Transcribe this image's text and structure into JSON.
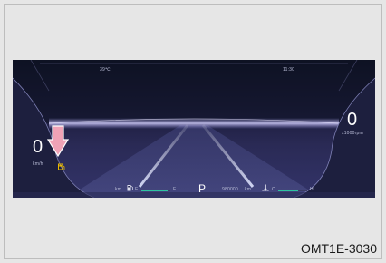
{
  "cluster": {
    "outside_temp": "39℃",
    "clock": "11:30",
    "speed": "0",
    "speed_unit": "km/h",
    "rpm": "0",
    "rpm_unit": "x1000rpm",
    "gear": "P",
    "odometer": "980000",
    "odometer_unit": "km",
    "fuel_range_unit": "km",
    "fuel_empty_label": "E",
    "fuel_full_label": "F",
    "temp_cold_label": "C",
    "temp_hot_label": "H",
    "fuel_level": 0.9,
    "temp_level": 0.7
  },
  "caption": "OMT1E-3030",
  "colors": {
    "arrow": "#f0a2b6",
    "warning_icon": "#e8b800",
    "gauge_bar": "#2ec4a0"
  },
  "icons": {
    "fuel": "fuel-pump-icon",
    "coolant": "coolant-temp-icon",
    "warning": "low-fuel-warning-icon"
  }
}
